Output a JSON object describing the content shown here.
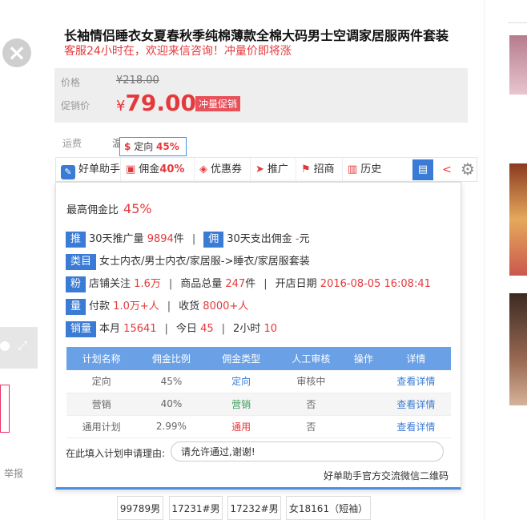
{
  "product": {
    "title": "长袖情侣睡衣女夏春秋季纯棉薄款全棉大码男士空调家居服两件套装",
    "subtitle": "客服24小时在，欢迎来信咨询！冲量价即将涨"
  },
  "price": {
    "label": "价格",
    "original": "¥218.00",
    "promo_label": "促销价",
    "currency": "¥",
    "promo_value": "79.00",
    "promo_tag": "冲量促销"
  },
  "shipping": {
    "label": "运费",
    "value": "温"
  },
  "tooltip": {
    "prefix": "$",
    "text": "定向",
    "percent": "45%"
  },
  "toolbar": {
    "brand": "好单助手",
    "commission_label": "佣金",
    "commission_pct": "40%",
    "coupon": "优惠券",
    "promote": "推广",
    "recruit": "招商",
    "history": "历史"
  },
  "panel": {
    "max_rate_label": "最高佣金比",
    "max_rate": "45%",
    "row1": {
      "tag1": "推",
      "promo_count_label": "30天推广量",
      "promo_count": "9894",
      "unit": "件",
      "tag2": "佣",
      "commission_paid_label": "30天支出佣金",
      "commission_paid": "-",
      "unit2": "元"
    },
    "row2": {
      "tag": "类目",
      "category": "女士内衣/男士内衣/家居服->睡衣/家居服套装"
    },
    "row3": {
      "tag": "粉",
      "shop_follow_label": "店铺关注",
      "shop_follow": "1.6万",
      "goods_total_label": "商品总量",
      "goods_total": "247",
      "goods_unit": "件",
      "open_date_label": "开店日期",
      "open_date": "2016-08-05 16:08:41"
    },
    "row4": {
      "tag": "量",
      "paid_label": "付款",
      "paid": "1.0万+人",
      "received_label": "收货",
      "received": "8000+人"
    },
    "row5": {
      "tag": "销量",
      "month_label": "本月",
      "month": "15641",
      "today_label": "今日",
      "today": "45",
      "hours_label": "2小时",
      "hours": "10"
    },
    "table": {
      "headers": [
        "计划名称",
        "佣金比例",
        "佣金类型",
        "人工审核",
        "操作",
        "详情"
      ],
      "rows": [
        [
          "定向",
          "45%",
          "定向",
          "审核中",
          "",
          "查看详情"
        ],
        [
          "营销",
          "40%",
          "营销",
          "否",
          "",
          "查看详情"
        ],
        [
          "通用计划",
          "2.99%",
          "通用",
          "否",
          "",
          "查看详情"
        ]
      ]
    },
    "reason_label": "在此填入计划申请理由:",
    "reason_value": "请允许通过,谢谢!",
    "wechat_link": "好单助手官方交流微信二维码"
  },
  "left": {
    "report": "举报"
  },
  "sku": [
    "99789男",
    "17231#男",
    "17232#男",
    "女18161（短袖）"
  ],
  "colors": {
    "accent_red": "#e4393c",
    "accent_blue": "#3a7bd5",
    "table_header": "#6aa0e6"
  }
}
